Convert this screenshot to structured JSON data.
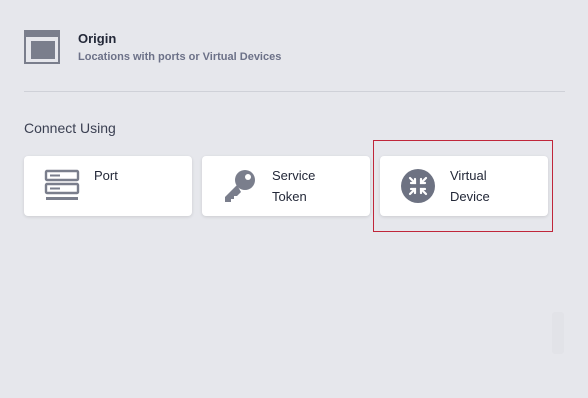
{
  "origin": {
    "title": "Origin",
    "subtitle": "Locations with ports or Virtual Devices",
    "icon": "browser-window-icon"
  },
  "connect": {
    "heading": "Connect Using",
    "options": [
      {
        "line1": "Port",
        "line2": "",
        "icon": "server-icon"
      },
      {
        "line1": "Service",
        "line2": "Token",
        "icon": "key-icon"
      },
      {
        "line1": "Virtual",
        "line2": "Device",
        "icon": "virtual-device-icon"
      }
    ]
  },
  "colors": {
    "background": "#e6e7ec",
    "card": "#ffffff",
    "icon": "#7a7e8c",
    "highlight": "#c0263a"
  }
}
